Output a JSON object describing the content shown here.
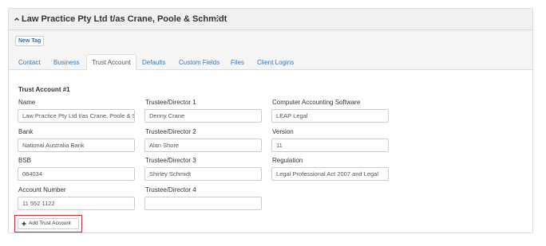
{
  "panel": {
    "title": "Law Practice Pty Ltd t/as Crane, Poole & Schmidt",
    "collapse_icon": "chevron-up-icon",
    "edit_icon": "pencil-icon"
  },
  "toolbar": {
    "new_tag_label": "New Tag"
  },
  "tabs": [
    {
      "label": "Contact"
    },
    {
      "label": "Business"
    },
    {
      "label": "Trust Account",
      "active": true
    },
    {
      "label": "Defaults"
    },
    {
      "label": "Custom Fields"
    },
    {
      "label": "Files"
    },
    {
      "label": "Client Logins"
    }
  ],
  "trust_account": {
    "section_title": "Trust Account #1",
    "name": {
      "label": "Name",
      "value": "Law Practice Pty Ltd t/as Crane, Poole & Schmidt"
    },
    "bank": {
      "label": "Bank",
      "value": "National Australia Bank"
    },
    "bsb": {
      "label": "BSB",
      "value": "084034"
    },
    "account_number": {
      "label": "Account Number",
      "value": "11 552 1122"
    },
    "trustee_1": {
      "label": "Trustee/Director 1",
      "value": "Denny Crane"
    },
    "trustee_2": {
      "label": "Trustee/Director 2",
      "value": "Alan Shore"
    },
    "trustee_3": {
      "label": "Trustee/Director 3",
      "value": "Shirley Schmidt"
    },
    "trustee_4": {
      "label": "Trustee/Director 4",
      "value": ""
    },
    "software": {
      "label": "Computer Accounting Software",
      "value": "LEAP Legal"
    },
    "version": {
      "label": "Version",
      "value": "11"
    },
    "regulation": {
      "label": "Regulation",
      "value": "Legal Professional Act 2007 and Legal"
    },
    "add_button_label": "Add Trust Account",
    "add_icon": "plus-icon"
  },
  "colors": {
    "link": "#337ab7",
    "highlight_border": "#d9232d"
  }
}
